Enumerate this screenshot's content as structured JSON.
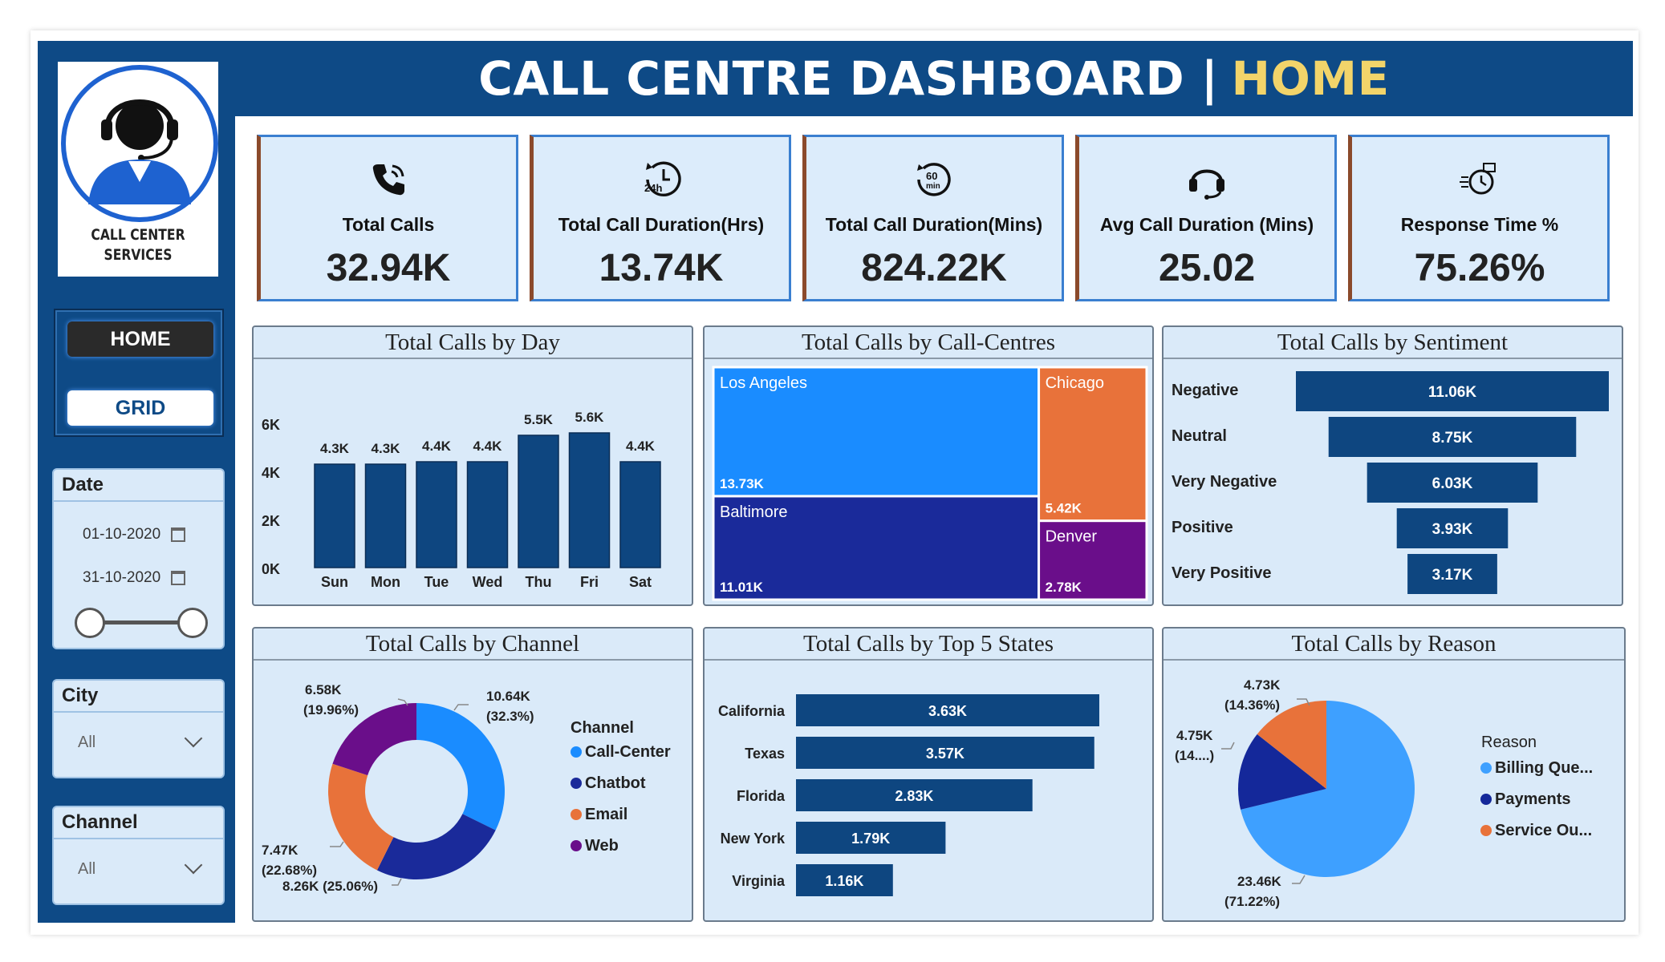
{
  "header": {
    "title_main": "CALL CENTRE DASHBOARD |",
    "title_accent": "HOME"
  },
  "logo": {
    "line1": "CALL CENTER",
    "line2": "SERVICES"
  },
  "nav": {
    "home_label": "HOME",
    "grid_label": "GRID"
  },
  "slicers": {
    "date": {
      "title": "Date",
      "start": "01-10-2020",
      "end": "31-10-2020"
    },
    "city": {
      "title": "City",
      "value": "All"
    },
    "channel": {
      "title": "Channel",
      "value": "All"
    }
  },
  "kpis": [
    {
      "label": "Total Calls",
      "value": "32.94K",
      "icon": "phone-icon"
    },
    {
      "label": "Total Call Duration(Hrs)",
      "value": "13.74K",
      "icon": "clock-24h-icon"
    },
    {
      "label": "Total Call Duration(Mins)",
      "value": "824.22K",
      "icon": "timer-60min-icon"
    },
    {
      "label": "Avg Call Duration (Mins)",
      "value": "25.02",
      "icon": "headset-icon"
    },
    {
      "label": "Response Time %",
      "value": "75.26%",
      "icon": "stopwatch-icon"
    }
  ],
  "colors": {
    "navy": "#0e4a86",
    "gold": "#f2d46a",
    "panel_bg": "#daeaf9",
    "bar": "#0e4680",
    "callcenter": "#1a8cff",
    "chatbot": "#1a2a9a",
    "email": "#e8723a",
    "web": "#6a0e8a",
    "billing": "#3ea0ff",
    "payments": "#14289a",
    "service": "#e8723a"
  },
  "panels": {
    "by_day": {
      "title": "Total Calls by Day"
    },
    "by_centre": {
      "title": "Total Calls by Call-Centres"
    },
    "by_sentiment": {
      "title": "Total Calls by Sentiment"
    },
    "by_channel": {
      "title": "Total Calls by Channel"
    },
    "by_state": {
      "title": "Total Calls by Top 5 States"
    },
    "by_reason": {
      "title": "Total Calls by Reason"
    }
  },
  "chart_data": [
    {
      "id": "by_day",
      "type": "bar",
      "categories": [
        "Sun",
        "Mon",
        "Tue",
        "Wed",
        "Thu",
        "Fri",
        "Sat"
      ],
      "values": [
        4300,
        4300,
        4400,
        4400,
        5500,
        5600,
        4400
      ],
      "labels": [
        "4.3K",
        "4.3K",
        "4.4K",
        "4.4K",
        "5.5K",
        "5.6K",
        "4.4K"
      ],
      "ylim": [
        0,
        6000
      ],
      "yticks": [
        "0K",
        "2K",
        "4K",
        "6K"
      ],
      "yticks_values": [
        0,
        2000,
        4000,
        6000
      ]
    },
    {
      "id": "by_centre",
      "type": "treemap",
      "items": [
        {
          "name": "Los Angeles",
          "value": 13730,
          "label": "13.73K"
        },
        {
          "name": "Baltimore",
          "value": 11010,
          "label": "11.01K"
        },
        {
          "name": "Chicago",
          "value": 5420,
          "label": "5.42K"
        },
        {
          "name": "Denver",
          "value": 2780,
          "label": "2.78K"
        }
      ]
    },
    {
      "id": "by_sentiment",
      "type": "bar",
      "orientation": "funnel",
      "categories": [
        "Negative",
        "Neutral",
        "Very Negative",
        "Positive",
        "Very Positive"
      ],
      "values": [
        11060,
        8750,
        6030,
        3930,
        3170
      ],
      "labels": [
        "11.06K",
        "8.75K",
        "6.03K",
        "3.93K",
        "3.17K"
      ]
    },
    {
      "id": "by_channel",
      "type": "pie",
      "donut": true,
      "legend_title": "Channel",
      "categories": [
        "Call-Center",
        "Chatbot",
        "Email",
        "Web"
      ],
      "values": [
        10640,
        8260,
        7470,
        6580
      ],
      "labels": [
        [
          "10.64K",
          "(32.3%)"
        ],
        [
          "8.26K (25.06%)"
        ],
        [
          "7.47K",
          "(22.68%)"
        ],
        [
          "6.58K",
          "(19.96%)"
        ]
      ]
    },
    {
      "id": "by_state",
      "type": "bar",
      "orientation": "horizontal",
      "categories": [
        "California",
        "Texas",
        "Florida",
        "New York",
        "Virginia"
      ],
      "values": [
        3630,
        3570,
        2830,
        1790,
        1160
      ],
      "labels": [
        "3.63K",
        "3.57K",
        "2.83K",
        "1.79K",
        "1.16K"
      ]
    },
    {
      "id": "by_reason",
      "type": "pie",
      "legend_title": "Reason",
      "categories": [
        "Billing Que...",
        "Payments",
        "Service Ou..."
      ],
      "values": [
        23460,
        4750,
        4730
      ],
      "labels": [
        [
          "23.46K",
          "(71.22%)"
        ],
        [
          "4.75K",
          "(14....)"
        ],
        [
          "4.73K",
          "(14.36%)"
        ]
      ]
    }
  ]
}
